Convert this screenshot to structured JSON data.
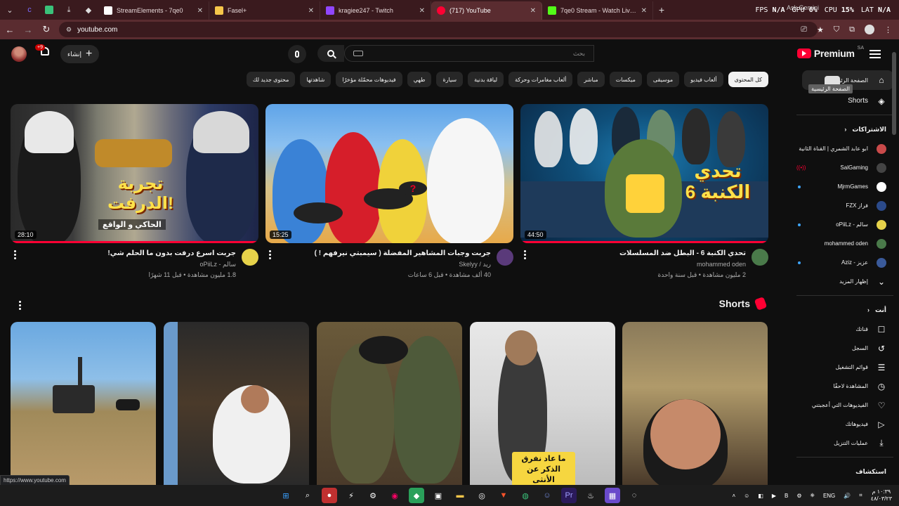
{
  "browser": {
    "tabs": [
      {
        "label": "StreamElements - 7qe0",
        "icon_color": "#ffffff",
        "active": false
      },
      {
        "label": "Fasel+",
        "icon_color": "#f6c64a",
        "active": false
      },
      {
        "label": "kragiee247 - Twitch",
        "icon_color": "#9146ff",
        "active": false
      },
      {
        "label": "(717) YouTube",
        "icon_color": "#ff0033",
        "active": true
      },
      {
        "label": "7qe0 Stream - Watch Live on Kick",
        "icon_color": "#53fc18",
        "active": false
      }
    ],
    "stats": {
      "fps_label": "FPS",
      "fps": "N/A",
      "gpu_label": "GPU",
      "gpu": "6%",
      "cpu_label": "CPU",
      "cpu": "15%",
      "lat_label": "LAT",
      "lat": "N/A"
    },
    "ask_gemini": "Ask Gemini",
    "url": "youtube.com",
    "status_url": "https://www.youtube.com"
  },
  "header": {
    "logo_text": "Premium",
    "logo_region": "SA",
    "search_placeholder": "بحث",
    "create_label": "إنشاء",
    "notif_badge": "+9"
  },
  "chips": [
    {
      "label": "كل المحتوى",
      "active": true
    },
    {
      "label": "ألعاب فيديو",
      "active": false
    },
    {
      "label": "موسيقى",
      "active": false
    },
    {
      "label": "ميكسات",
      "active": false
    },
    {
      "label": "مباشر",
      "active": false
    },
    {
      "label": "ألعاب مغامرات وحركة",
      "active": false
    },
    {
      "label": "لياقة بدنية",
      "active": false
    },
    {
      "label": "سيارة",
      "active": false
    },
    {
      "label": "طهي",
      "active": false
    },
    {
      "label": "فيديوهات محمّلة مؤخرًا",
      "active": false
    },
    {
      "label": "شاهدتها",
      "active": false
    },
    {
      "label": "محتوى جديد لك",
      "active": false
    }
  ],
  "videos": [
    {
      "title": "تحدي الكنبة 6 - البطل ضد المسلسلات",
      "channel": "mohammed oden",
      "meta": "2 مليون مشاهدة • قبل سنة واحدة",
      "duration": "44:50",
      "thumb_text": "تحدي الكنبة 6",
      "progress": 1.0
    },
    {
      "title": "جربت وجبات المشاهير المفضلة ( سيمبتي نيرفهم ! )",
      "channel": "ريد / Skelyy",
      "meta": "40 ألف مشاهدة • قبل 6 ساعات",
      "duration": "15:25",
      "thumb_text": "?",
      "progress": 0
    },
    {
      "title": "جربت اسرع درفت بدون ما الحلم شي!",
      "channel": "سالم - oPiiLz",
      "meta": "1.8 مليون مشاهدة • قبل 11 شهرًا",
      "duration": "28:10",
      "thumb_text": "تجربة الدرفت!",
      "thumb_sub": "الحاكي و الواقع",
      "progress": 1.0
    }
  ],
  "shorts": {
    "title": "Shorts",
    "items": [
      {
        "caption": ""
      },
      {
        "caption": "ما عاد نفرق الذكر عن الأنثى"
      },
      {
        "caption": ""
      },
      {
        "caption": ""
      },
      {
        "caption": ""
      }
    ]
  },
  "sidebar": {
    "home_label": "الصفحة الرئيسية",
    "home_tooltip": "الصفحة الرئيسية",
    "shorts_label": "Shorts",
    "subs_title": "الاشتراكات",
    "subscriptions": [
      {
        "name": "ابو عابد الشمري | القناة الثانية",
        "color": "#c94a4a",
        "indicator": ""
      },
      {
        "name": "SalGaming",
        "color": "#444444",
        "indicator": "live"
      },
      {
        "name": "MjrmGames",
        "color": "#ffffff",
        "indicator": "dot"
      },
      {
        "name": "فراز FZX",
        "color": "#2b4a8a",
        "indicator": ""
      },
      {
        "name": "سالم - oPiiLz",
        "color": "#e6d24a",
        "indicator": "dot"
      },
      {
        "name": "mohammed oden",
        "color": "#4a7a4a",
        "indicator": ""
      },
      {
        "name": "عزيز - Aziz",
        "color": "#3a5a9a",
        "indicator": "dot"
      }
    ],
    "show_more": "إظهار المزيد",
    "you_title": "أنت",
    "you_items": [
      {
        "label": "قناتك",
        "icon": "channel-icon"
      },
      {
        "label": "السجل",
        "icon": "history-icon"
      },
      {
        "label": "قوائم التشغيل",
        "icon": "playlists-icon"
      },
      {
        "label": "المشاهدة لاحقًا",
        "icon": "watch-later-icon"
      },
      {
        "label": "الفيديوهات التي أعجبتني",
        "icon": "like-icon"
      },
      {
        "label": "فيديوهاتك",
        "icon": "your-videos-icon"
      },
      {
        "label": "عمليات التنزيل",
        "icon": "download-icon"
      }
    ],
    "explore_title": "استكشاف"
  },
  "taskbar": {
    "lang": "ENG",
    "time": "١٠:٣٩ م",
    "date": "٤٨/٠٣/٢٣"
  }
}
